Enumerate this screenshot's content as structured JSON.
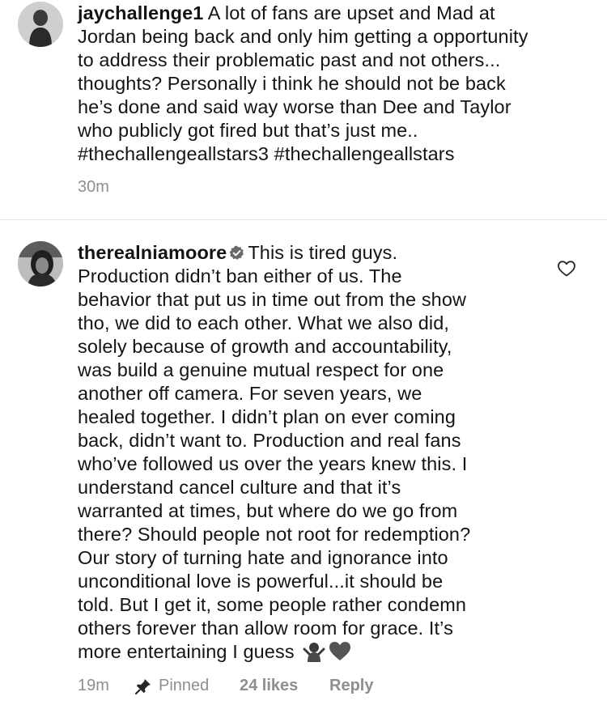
{
  "comment1": {
    "username": "jaychallenge1",
    "avatar_icon": "user-avatar",
    "lines": [
      "A lot of fans are upset and Mad at",
      "Jordan being back and only him getting a opportunity",
      "to address their problematic past and not others...",
      "thoughts? Personally i think he should not be back",
      "he’s done and said way worse than Dee and Taylor",
      "who publicly got fired but that’s just me..",
      "#thechallengeallstars3 #thechallengeallstars"
    ],
    "time": "30m"
  },
  "comment2": {
    "username": "therealniamoore",
    "avatar_icon": "user-avatar",
    "verified_icon": "verified-badge-icon",
    "first_line": "This is tired guys.",
    "lines": [
      "Production didn’t ban either of us. The",
      "behavior that put us in time out from the show",
      "tho, we did to each other. What we also did,",
      "solely because of growth and accountability,",
      "was build a genuine mutual respect for one",
      "another off camera. For seven years, we",
      "healed together. I didn’t plan on ever coming",
      "back, didn’t want to. Production and real fans",
      "who’ve followed us over the years knew this. I",
      "understand cancel culture and that it’s",
      "warranted at times, but where do we go from",
      "there? Should people not root for redemption?",
      "Our story of turning hate and ignorance into",
      "unconditional love is powerful...it should be",
      "told. But I get it, some people rather condemn",
      "others forever than allow room for grace. It’s"
    ],
    "last_line": "more entertaining I guess",
    "emojis": [
      "woman-shrugging-emoji",
      "black-heart-emoji"
    ],
    "time": "19m",
    "pin_icon": "pin-icon",
    "pinned_label": "Pinned",
    "likes": "24 likes",
    "reply_label": "Reply",
    "like_icon": "heart-outline-icon"
  }
}
